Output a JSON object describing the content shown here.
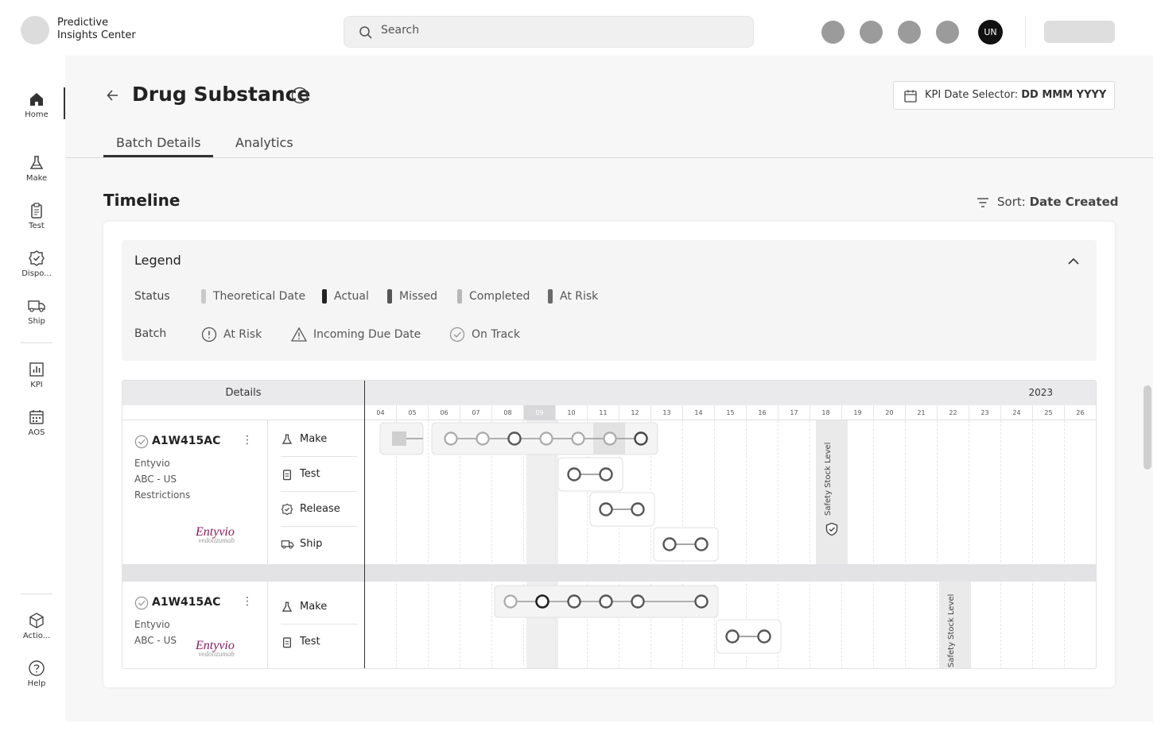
{
  "app": {
    "brand_line1": "Predictive",
    "brand_line2": "Insights Center",
    "user_initials": "UN"
  },
  "search": {
    "placeholder": "Search",
    "value": ""
  },
  "sidebar": {
    "items": [
      {
        "label": "Home",
        "icon": "home-icon",
        "active": true
      },
      {
        "label": "Make",
        "icon": "flask-icon"
      },
      {
        "label": "Test",
        "icon": "clipboard-icon"
      },
      {
        "label": "Dispo...",
        "icon": "badge-check-icon"
      },
      {
        "label": "Ship",
        "icon": "truck-icon"
      },
      {
        "label": "KPI",
        "icon": "bar-chart-icon"
      },
      {
        "label": "AOS",
        "icon": "calendar-icon"
      },
      {
        "label": "Actio...",
        "icon": "cube-icon"
      },
      {
        "label": "Help",
        "icon": "help-icon"
      }
    ]
  },
  "header": {
    "title": "Drug Substance",
    "kpi_label": "KPI Date Selector:",
    "kpi_value": "DD MMM YYYY"
  },
  "tabs": [
    {
      "label": "Batch Details",
      "active": true
    },
    {
      "label": "Analytics",
      "active": false
    }
  ],
  "timeline": {
    "title": "Timeline",
    "sort_label": "Sort:",
    "sort_value": "Date Created"
  },
  "legend": {
    "title": "Legend",
    "status_label": "Status",
    "status_items": [
      {
        "label": "Theoretical Date",
        "color": "#c9c9c9"
      },
      {
        "label": "Actual",
        "color": "#222222"
      },
      {
        "label": "Missed",
        "color": "#555555"
      },
      {
        "label": "Completed",
        "color": "#b8b8b8"
      },
      {
        "label": "At Risk",
        "color": "#6a6a6a"
      }
    ],
    "batch_label": "Batch",
    "batch_items": [
      {
        "label": "At Risk",
        "icon": "alert-circle-icon"
      },
      {
        "label": "Incoming Due Date",
        "icon": "warning-triangle-icon"
      },
      {
        "label": "On Track",
        "icon": "check-circle-icon"
      }
    ]
  },
  "table": {
    "details_header": "Details",
    "year": "2023",
    "weeks": [
      "04",
      "05",
      "06",
      "07",
      "08",
      "09",
      "10",
      "11",
      "12",
      "13",
      "14",
      "15",
      "16",
      "17",
      "18",
      "19",
      "20",
      "21",
      "22",
      "23",
      "24",
      "25",
      "26"
    ],
    "current_week": "09",
    "safety_stock_label": "Safety Stock Level",
    "batches": [
      {
        "id": "A1W415AC",
        "product": "Entyvio",
        "region": "ABC - US",
        "note": "Restrictions",
        "logo_text": "Entyvio",
        "logo_sub": "vedolizumab",
        "steps": [
          "Make",
          "Test",
          "Release",
          "Ship"
        ]
      },
      {
        "id": "A1W415AC",
        "product": "Entyvio",
        "region": "ABC - US",
        "logo_text": "Entyvio",
        "logo_sub": "vedolizumab",
        "steps": [
          "Make",
          "Test"
        ]
      }
    ]
  }
}
